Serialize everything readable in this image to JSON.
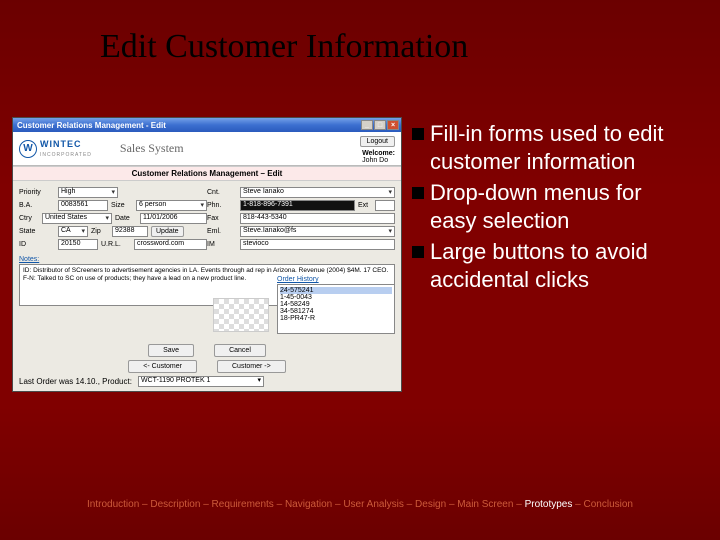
{
  "slide": {
    "title": "Edit Customer Information",
    "bullets": [
      "Fill-in forms used to edit customer information",
      "Drop-down menus for easy selection",
      "Large buttons to avoid accidental clicks"
    ],
    "breadcrumb": {
      "items": [
        "Introduction",
        "Description",
        "Requirements",
        "Navigation",
        "User Analysis",
        "Design",
        "Main Screen",
        "Prototypes",
        "Conclusion"
      ],
      "sep": " – ",
      "active_index": 7
    }
  },
  "app": {
    "window_title": "Customer Relations Management - Edit",
    "logout_label": "Logout",
    "brand": {
      "name": "WINTEC",
      "sub": "INCORPORATED"
    },
    "system_name": "Sales System",
    "welcome_label": "Welcome:",
    "welcome_user": "John Do",
    "section_title": "Customer Relations Management – Edit",
    "left_fields": {
      "priority_label": "Priority",
      "priority": "High",
      "ba_label": "B.A.",
      "ba": "0083561",
      "size_label": "Size",
      "size": "6 person",
      "country_label": "Country",
      "country": "United States",
      "state_label": "State",
      "state": "CA",
      "zip_label": "Zip",
      "zip": "92388",
      "id_label": "ID",
      "id": "20150",
      "url_label": "U.R.L.",
      "url": "crossword.com",
      "date_label": "Date",
      "date": "11/01/2006",
      "update_label": "Update"
    },
    "right_fields": {
      "cnt_label": "Cnt.",
      "cnt": "Steve Ianako",
      "phn_label": "Phn.",
      "phn": "1-818-896-7391",
      "ext_label": "Ext",
      "ext": "",
      "fax_label": "Fax",
      "fax": "818-443-5340",
      "eml_label": "Eml.",
      "eml": "Steve.Ianako@fs",
      "im_label": "IM",
      "im": "stevioco"
    },
    "notes_label": "Notes:",
    "notes": "ID: Distributor of SCreeners to advertisement agencies in LA. Events through ad rep in Arizona. Revenue (2004) $4M. 17 CEO.\n\nF-N: Talked to SC on use of products; they have a lead on a new product line.",
    "orderlist_label": "Order History",
    "orders": [
      "24-575241",
      "1-45-0043",
      "14-58249",
      "34-581274",
      "18-PR47-R"
    ],
    "order_selected_index": 0,
    "buttons": {
      "save": "Save",
      "cancel": "Cancel",
      "prev": "<- Customer",
      "next": "Customer ->"
    },
    "footer": {
      "last_label": "Last Order was 14.10., Product:",
      "product": "WCT-1190 PROTEK 1"
    }
  }
}
